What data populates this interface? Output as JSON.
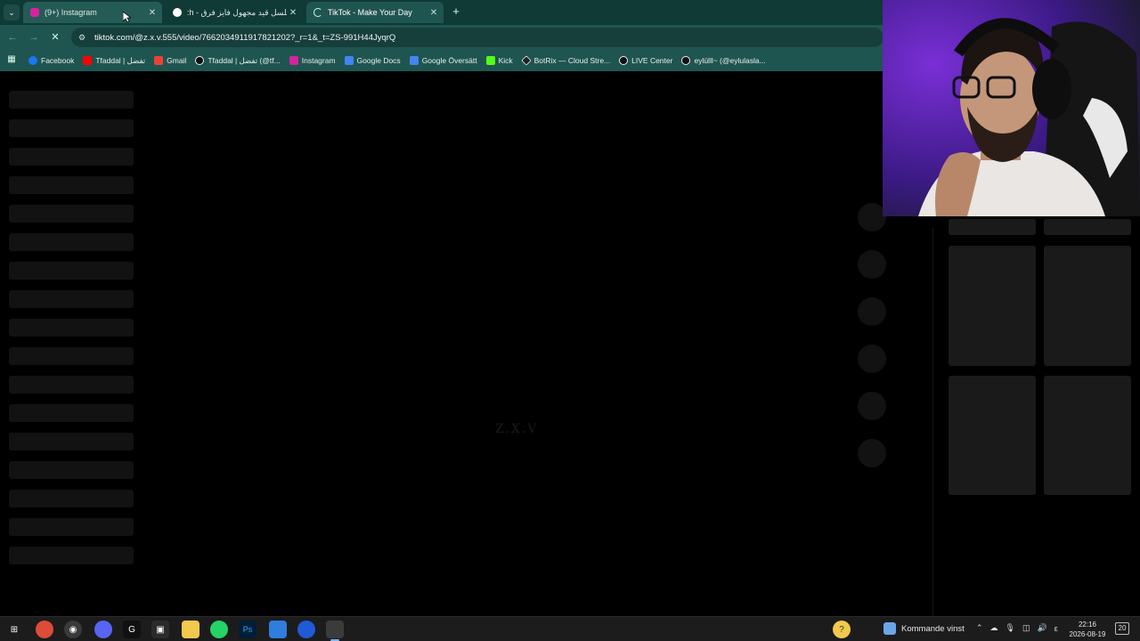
{
  "browser": {
    "tabs": [
      {
        "label": "(9+) Instagram",
        "state": "inactive",
        "favicon": "instagram-icon",
        "favicon_color": "#d6249f"
      },
      {
        "label": ":h - مسلسل قيد مجهول فايز فرق",
        "state": "inactive",
        "favicon": "google-icon",
        "favicon_color": "#ffffff"
      },
      {
        "label": "TikTok - Make Your Day",
        "state": "active-loading",
        "favicon": "loading-icon",
        "favicon_color": "#cfe"
      }
    ],
    "url": "tiktok.com/@z.x.v.555/video/7662034911917821202?_r=1&_t=ZS-991H44JyqrQ",
    "bookmarks": [
      {
        "label": "Facebook",
        "icon": "facebook-icon",
        "color": "#1877f2"
      },
      {
        "label": "Tfaddal | تفضل",
        "icon": "youtube-icon",
        "color": "#ff0000"
      },
      {
        "label": "Gmail",
        "icon": "gmail-icon",
        "color": "#ea4335"
      },
      {
        "label": "Tfaddal | تفضل (@tf...",
        "icon": "tiktok-icon",
        "color": "#111111"
      },
      {
        "label": "Instagram",
        "icon": "instagram-icon",
        "color": "#d6249f"
      },
      {
        "label": "Google Docs",
        "icon": "docs-icon",
        "color": "#4285f4"
      },
      {
        "label": "Google Översätt",
        "icon": "translate-icon",
        "color": "#4285f4"
      },
      {
        "label": "Kick",
        "icon": "kick-icon",
        "color": "#53fc18"
      },
      {
        "label": "BotRix — Cloud Stre...",
        "icon": "botrix-icon",
        "color": "#222222"
      },
      {
        "label": "LIVE Center",
        "icon": "tiktok-icon",
        "color": "#111111"
      },
      {
        "label": "eylülll~ (@eylulasla...",
        "icon": "tiktok-icon",
        "color": "#111111"
      }
    ]
  },
  "page": {
    "watermark": "Z.X.V"
  },
  "taskbar": {
    "weather_label": "Kommande vinst",
    "time": "22:16",
    "date": "2026-08-19",
    "notification_count": "20",
    "tray_lang": "ε"
  }
}
